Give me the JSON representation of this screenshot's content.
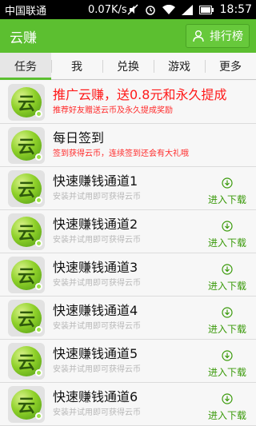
{
  "statusbar": {
    "carrier": "中国联通",
    "speed": "0.07K/s",
    "time": "18:57"
  },
  "app": {
    "title": "云赚",
    "rank_label": "排行榜",
    "accent": "#5cbf30"
  },
  "tabs": [
    {
      "label": "任务",
      "active": true
    },
    {
      "label": "我"
    },
    {
      "label": "兑换"
    },
    {
      "label": "游戏"
    },
    {
      "label": "更多"
    }
  ],
  "logo_char": "云",
  "tasks": [
    {
      "title": "推广云赚，送0.8元和永久提成",
      "subtitle": "推荐好友赠送云币及永久提成奖励"
    },
    {
      "title": "每日签到",
      "subtitle": "签到获得云币，连续签到还会有大礼哦"
    }
  ],
  "channels": [
    {
      "title": "快速赚钱通道1",
      "subtitle": "安装并试用即可获得云币",
      "action": "进入下载"
    },
    {
      "title": "快速赚钱通道2",
      "subtitle": "安装并试用即可获得云币",
      "action": "进入下载"
    },
    {
      "title": "快速赚钱通道3",
      "subtitle": "安装并试用即可获得云币",
      "action": "进入下载"
    },
    {
      "title": "快速赚钱通道4",
      "subtitle": "安装并试用即可获得云币",
      "action": "进入下载"
    },
    {
      "title": "快速赚钱通道5",
      "subtitle": "安装并试用即可获得云币",
      "action": "进入下载"
    },
    {
      "title": "快速赚钱通道6",
      "subtitle": "安装并试用即可获得云币",
      "action": "进入下载"
    }
  ]
}
